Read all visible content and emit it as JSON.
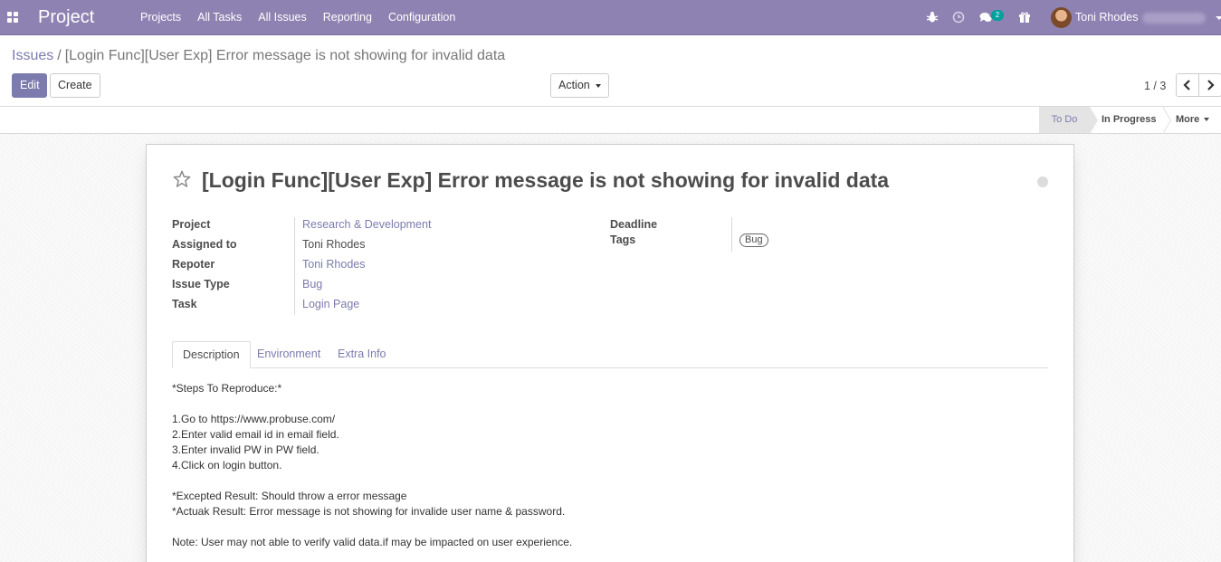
{
  "navbar": {
    "brand": "Project",
    "menu": [
      "Projects",
      "All Tasks",
      "All Issues",
      "Reporting",
      "Configuration"
    ],
    "chat_count": "2",
    "user_name": "Toni Rhodes"
  },
  "breadcrumb": {
    "parent": "Issues",
    "separator": "/",
    "current": "[Login Func][User Exp] Error message is not showing for invalid data"
  },
  "buttons": {
    "edit": "Edit",
    "create": "Create",
    "action": "Action"
  },
  "pager": {
    "value": "1 / 3"
  },
  "statusbar": {
    "stages": [
      "To Do",
      "In Progress"
    ],
    "active_stage": "To Do",
    "more": "More"
  },
  "form": {
    "title": "[Login Func][User Exp] Error message is not showing for invalid data",
    "left_fields": [
      {
        "label": "Project",
        "value": "Research & Development",
        "is_link": true
      },
      {
        "label": "Assigned to",
        "value": "Toni Rhodes",
        "is_link": false
      },
      {
        "label": "Repoter",
        "value": "Toni Rhodes",
        "is_link": true
      },
      {
        "label": "Issue Type",
        "value": "Bug",
        "is_link": true
      },
      {
        "label": "Task",
        "value": "Login Page",
        "is_link": true
      }
    ],
    "deadline_label": "Deadline",
    "deadline_value": "",
    "tags_label": "Tags",
    "tags": [
      "Bug"
    ],
    "tabs": [
      "Description",
      "Environment",
      "Extra Info"
    ],
    "active_tab": "Description",
    "description_lines": [
      "*Steps To Reproduce:*",
      "",
      "1.Go to https://www.probuse.com/",
      "2.Enter valid email id in email field.",
      "3.Enter invalid PW in PW field.",
      "4.Click on login button.",
      "",
      "*Excepted Result: Should throw a error message",
      "*Actuak Result: Error message is not showing for invalide user name & password.",
      "",
      "Note: User may not able to verify valid data.if may be impacted on user experience."
    ]
  },
  "colors": {
    "navbar": "#8e82b2",
    "accent": "#7c7bad",
    "chat_badge": "#00a09d"
  }
}
